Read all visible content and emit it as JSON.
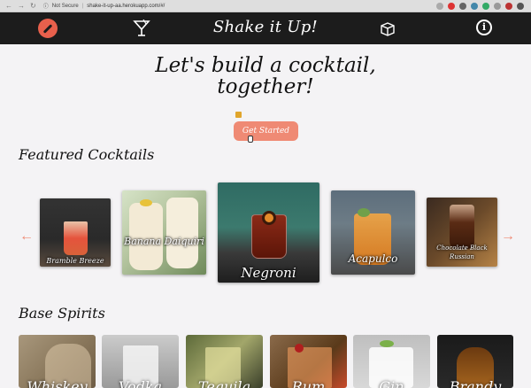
{
  "browser": {
    "security": "Not Secure",
    "separator": "|",
    "url": "shake-it-up-aa.herokuapp.com/#/"
  },
  "header": {
    "brand": "Shake it Up!",
    "info": "i"
  },
  "hero": {
    "line1": "Let's build a cocktail,",
    "line2": "together!",
    "cta": "Get Started"
  },
  "featured": {
    "title": "Featured Cocktails",
    "items": [
      {
        "name": "Bramble Breeze"
      },
      {
        "name": "Banana Daiquiri"
      },
      {
        "name": "Negroni"
      },
      {
        "name": "Acapulco"
      },
      {
        "name": "Chocolate Black Russian"
      }
    ]
  },
  "spirits": {
    "title": "Base Spirits",
    "items": [
      {
        "name": "Whiskey"
      },
      {
        "name": "Vodka"
      },
      {
        "name": "Tequila"
      },
      {
        "name": "Rum"
      },
      {
        "name": "Gin"
      },
      {
        "name": "Brandy"
      }
    ]
  },
  "colors": {
    "accent": "#ef8a74",
    "header_bg": "#1c1c1c",
    "page_bg": "#f4f3f5"
  }
}
